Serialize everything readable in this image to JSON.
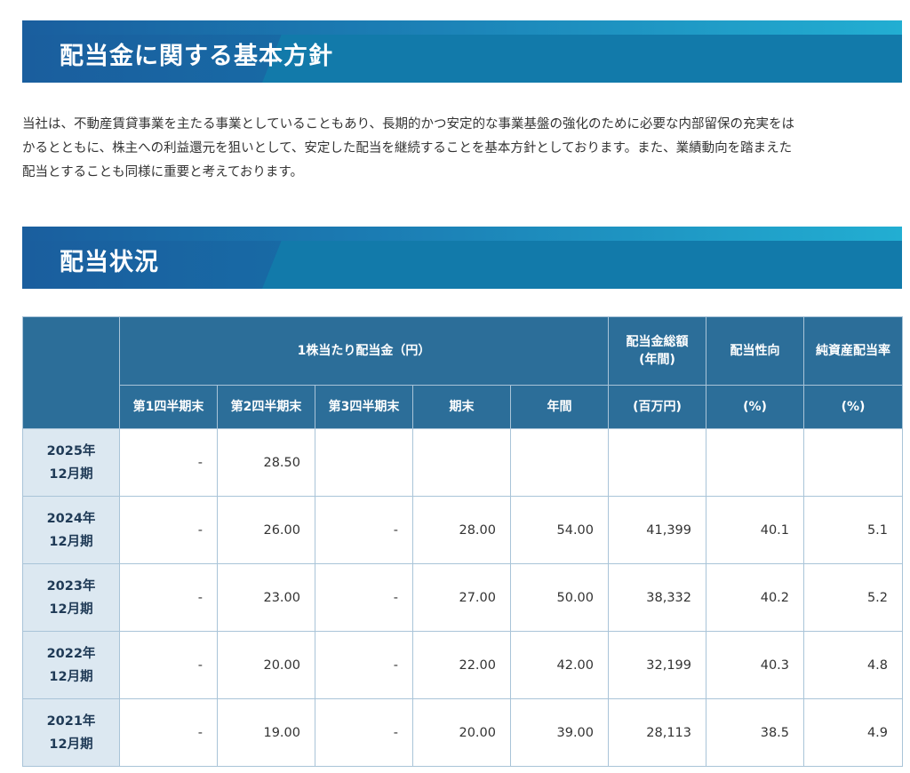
{
  "section1": {
    "title": "配当金に関する基本方針",
    "lines": [
      "当社は、不動産賃貸事業を主たる事業としていることもあり、長期的かつ安定的な事業基盤の強化のために必要な内部留保の充実をは",
      "かるとともに、株主への利益還元を狙いとして、安定した配当を継続することを基本方針としております。また、業績動向を踏まえた",
      "配当とすることも同様に重要と考えております。"
    ]
  },
  "section2": {
    "title": "配当状況"
  },
  "table": {
    "per_share_header": "1株当たり配当金（円）",
    "total_header": [
      "配当金総額",
      "(年間)"
    ],
    "payout_header": "配当性向",
    "doe_header": "純資産配当率",
    "subheaders": [
      "第1四半期末",
      "第2四半期末",
      "第3四半期末",
      "期末",
      "年間",
      "(百万円)",
      "(%)",
      "(%)"
    ],
    "rows": [
      {
        "period": [
          "2025年",
          "12月期"
        ],
        "q1": "-",
        "q2": "28.50",
        "q3": "",
        "end": "",
        "annual": "",
        "total": "",
        "payout": "",
        "doe": ""
      },
      {
        "period": [
          "2024年",
          "12月期"
        ],
        "q1": "-",
        "q2": "26.00",
        "q3": "-",
        "end": "28.00",
        "annual": "54.00",
        "total": "41,399",
        "payout": "40.1",
        "doe": "5.1"
      },
      {
        "period": [
          "2023年",
          "12月期"
        ],
        "q1": "-",
        "q2": "23.00",
        "q3": "-",
        "end": "27.00",
        "annual": "50.00",
        "total": "38,332",
        "payout": "40.2",
        "doe": "5.2"
      },
      {
        "period": [
          "2022年",
          "12月期"
        ],
        "q1": "-",
        "q2": "20.00",
        "q3": "-",
        "end": "22.00",
        "annual": "42.00",
        "total": "32,199",
        "payout": "40.3",
        "doe": "4.8"
      },
      {
        "period": [
          "2021年",
          "12月期"
        ],
        "q1": "-",
        "q2": "19.00",
        "q3": "-",
        "end": "20.00",
        "annual": "39.00",
        "total": "28,113",
        "payout": "38.5",
        "doe": "4.9"
      }
    ]
  }
}
